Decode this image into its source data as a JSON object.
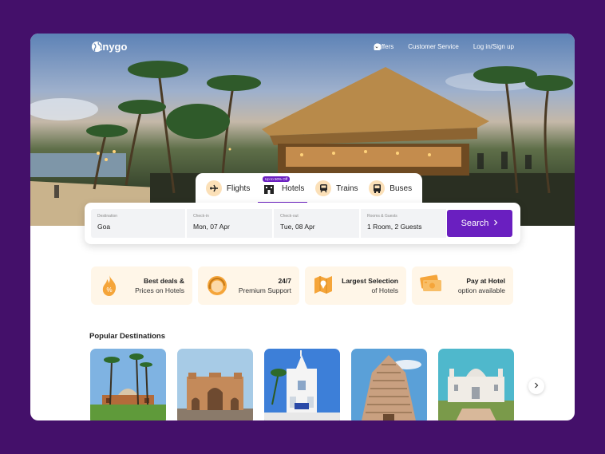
{
  "app": {
    "name": "Anygo"
  },
  "nav": {
    "offers": "Offers",
    "customer_service": "Customer Service",
    "login": "Log in/Sign up"
  },
  "tabs": [
    {
      "label": "Flights",
      "icon": "airplane-icon",
      "active": false
    },
    {
      "label": "Hotels",
      "icon": "hotel-icon",
      "active": true,
      "badge": "Up to 50% Off"
    },
    {
      "label": "Trains",
      "icon": "train-icon",
      "active": false
    },
    {
      "label": "Buses",
      "icon": "bus-icon",
      "active": false
    }
  ],
  "search": {
    "destination": {
      "label": "Destination",
      "value": "Goa"
    },
    "checkin": {
      "label": "Check-in",
      "value": "Mon, 07 Apr"
    },
    "checkout": {
      "label": "Check-out",
      "value": "Tue, 08 Apr"
    },
    "rooms": {
      "label": "Rooms & Guests",
      "value": "1 Room, 2 Guests"
    },
    "button": "Search"
  },
  "features": [
    {
      "title": "Best deals &",
      "subtitle": "Prices on Hotels",
      "icon": "deal-flame-icon"
    },
    {
      "title": "24/7",
      "subtitle": "Premium Support",
      "icon": "support-agent-icon"
    },
    {
      "title": "Largest Selection",
      "subtitle": "of Hotels",
      "icon": "map-pin-icon"
    },
    {
      "title": "Pay at Hotel",
      "subtitle": "option available",
      "icon": "cash-icon"
    }
  ],
  "popular": {
    "title": "Popular Destinations"
  },
  "colors": {
    "brand": "#6a1fc0",
    "background": "#44106a",
    "feature_bg": "#fff6e8",
    "icon_bg": "#fbe0b8"
  }
}
